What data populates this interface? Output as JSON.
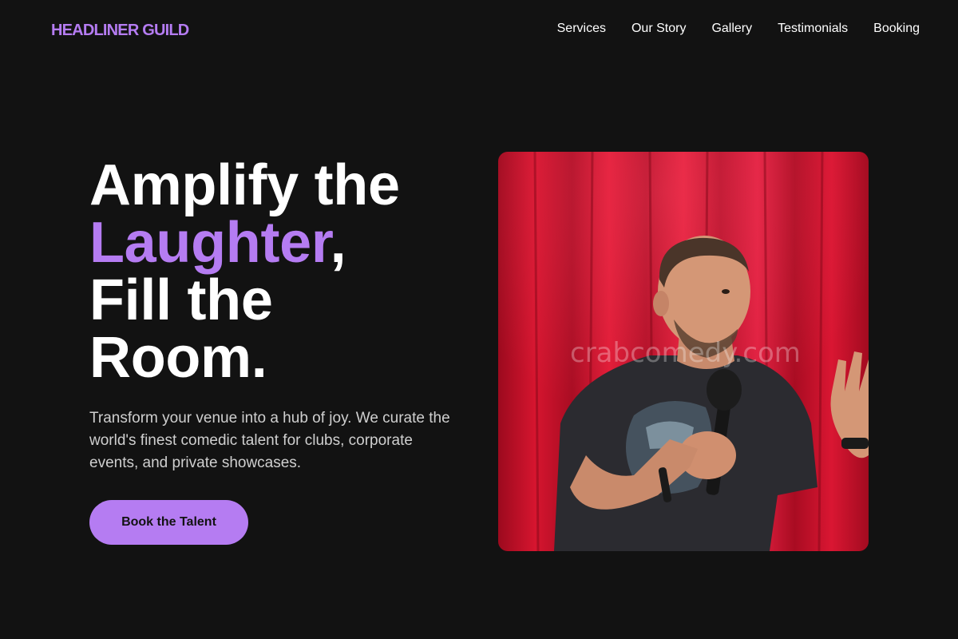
{
  "nav": {
    "logo": "HEADLINER GUILD",
    "links": [
      "Services",
      "Our Story",
      "Gallery",
      "Testimonials",
      "Booking"
    ]
  },
  "hero": {
    "title_line1": "Amplify the",
    "title_accent": "Laughter",
    "title_comma": ",",
    "title_line3": "Fill the",
    "title_line4": "Room.",
    "description": "Transform your venue into a hub of joy. We curate the world's finest comedic talent for clubs, corporate events, and private showcases.",
    "cta_label": "Book the Talent",
    "image_watermark": "crabcomedy.com"
  },
  "colors": {
    "background": "#121212",
    "accent": "#b57cf2",
    "curtain": "#d01530"
  }
}
